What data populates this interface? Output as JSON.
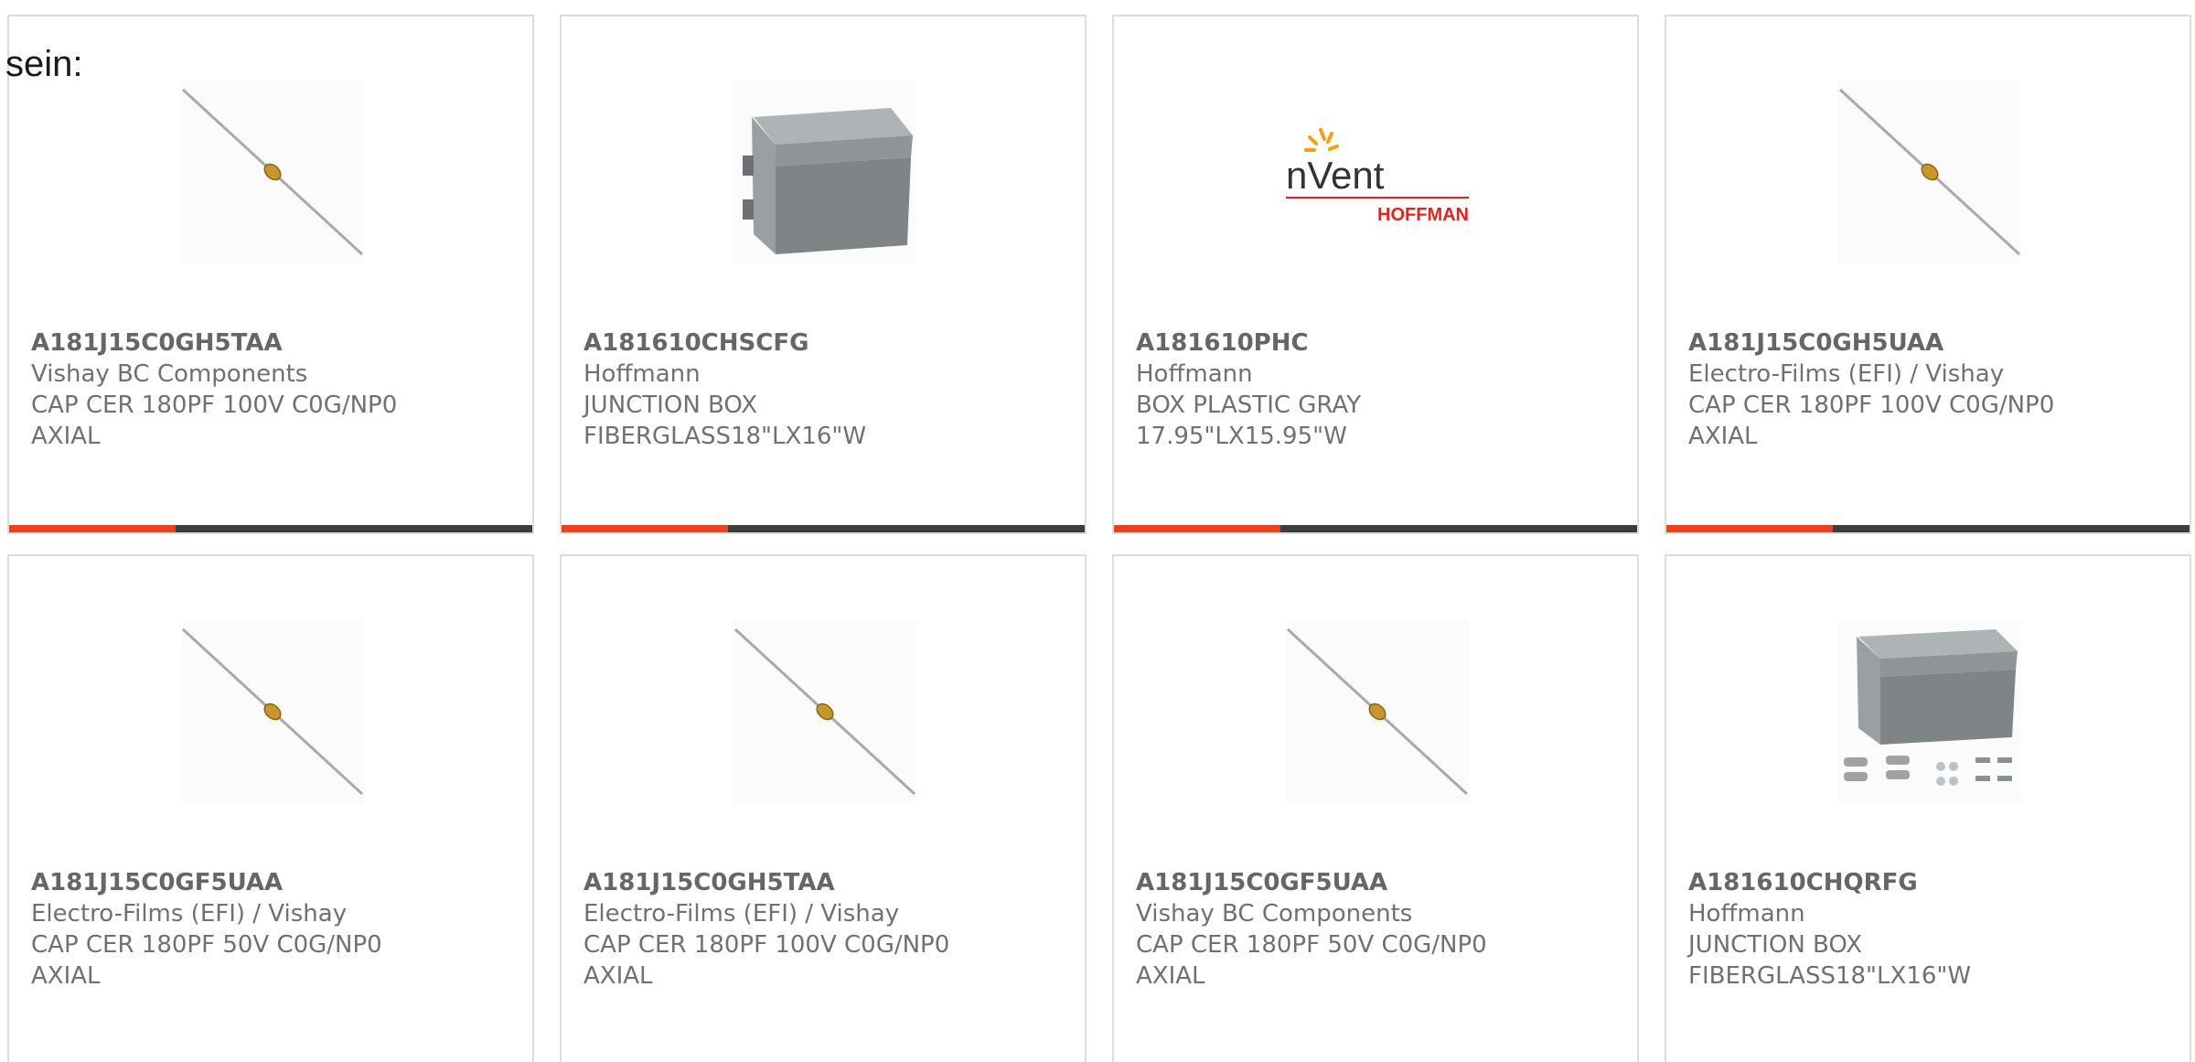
{
  "intro_text": "sein:",
  "colors": {
    "accent": "#e8411c",
    "bar_dark": "#3d3d3d",
    "text": "#707070",
    "border": "#dcdcdc"
  },
  "products": [
    {
      "part_number": "A181J15C0GH5TAA",
      "manufacturer": "Vishay BC Components",
      "desc1": "CAP CER 180PF 100V C0G/NP0",
      "desc2": "AXIAL",
      "image": "axial-capacitor-image"
    },
    {
      "part_number": "A181610CHSCFG",
      "manufacturer": "Hoffmann",
      "desc1": "JUNCTION BOX",
      "desc2": "FIBERGLASS18\"LX16\"W",
      "image": "junction-box-image"
    },
    {
      "part_number": "A181610PHC",
      "manufacturer": "Hoffmann",
      "desc1": "BOX PLASTIC GRAY",
      "desc2": "17.95\"LX15.95\"W",
      "image": "nvent-hoffman-logo",
      "logo_word": "nVent",
      "logo_sub": "HOFFMAN"
    },
    {
      "part_number": "A181J15C0GH5UAA",
      "manufacturer": "Electro-Films (EFI) / Vishay",
      "desc1": "CAP CER 180PF 100V C0G/NP0",
      "desc2": "AXIAL",
      "image": "axial-capacitor-image"
    },
    {
      "part_number": "A181J15C0GF5UAA",
      "manufacturer": "Electro-Films (EFI) / Vishay",
      "desc1": "CAP CER 180PF 50V C0G/NP0",
      "desc2": "AXIAL",
      "image": "axial-capacitor-image"
    },
    {
      "part_number": "A181J15C0GH5TAA",
      "manufacturer": "Electro-Films (EFI) / Vishay",
      "desc1": "CAP CER 180PF 100V C0G/NP0",
      "desc2": "AXIAL",
      "image": "axial-capacitor-image"
    },
    {
      "part_number": "A181J15C0GF5UAA",
      "manufacturer": "Vishay BC Components",
      "desc1": "CAP CER 180PF 50V C0G/NP0",
      "desc2": "AXIAL",
      "image": "axial-capacitor-image"
    },
    {
      "part_number": "A181610CHQRFG",
      "manufacturer": "Hoffmann",
      "desc1": "JUNCTION BOX",
      "desc2": "FIBERGLASS18\"LX16\"W",
      "image": "junction-box-kit-image"
    }
  ]
}
